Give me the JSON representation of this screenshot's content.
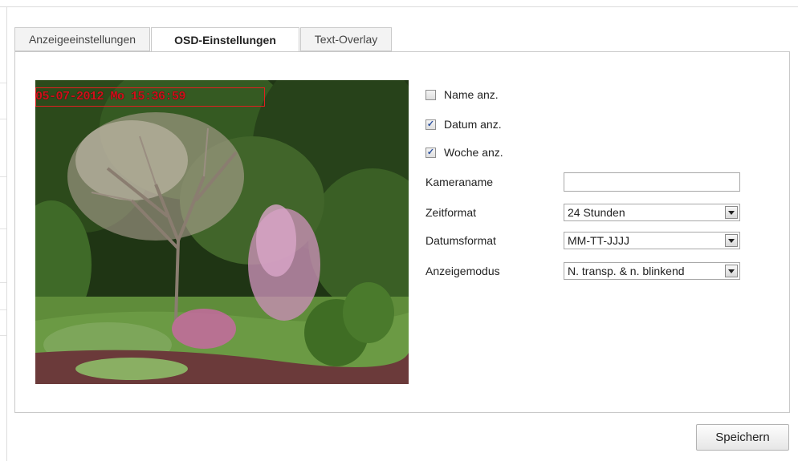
{
  "tabs": [
    {
      "label": "Anzeigeeinstellungen"
    },
    {
      "label": "OSD-Einstellungen"
    },
    {
      "label": "Text-Overlay"
    }
  ],
  "active_tab": "OSD-Einstellungen",
  "video": {
    "osd_overlay_text": "05-07-2012 Mo 15:36:59"
  },
  "checkboxes": [
    {
      "label": "Name anz.",
      "checked": false
    },
    {
      "label": "Datum anz.",
      "checked": true
    },
    {
      "label": "Woche anz.",
      "checked": true
    }
  ],
  "fields": {
    "camera_name": {
      "label": "Kameraname",
      "value": ""
    },
    "time_format": {
      "label": "Zeitformat",
      "value": "24 Stunden"
    },
    "date_format": {
      "label": "Datumsformat",
      "value": "MM-TT-JJJJ"
    },
    "display_mode": {
      "label": "Anzeigemodus",
      "value": "N. transp. & n. blinkend"
    }
  },
  "save_label": "Speichern",
  "icons": {
    "check": "checkmark-icon",
    "dropdown": "chevron-down-icon"
  }
}
